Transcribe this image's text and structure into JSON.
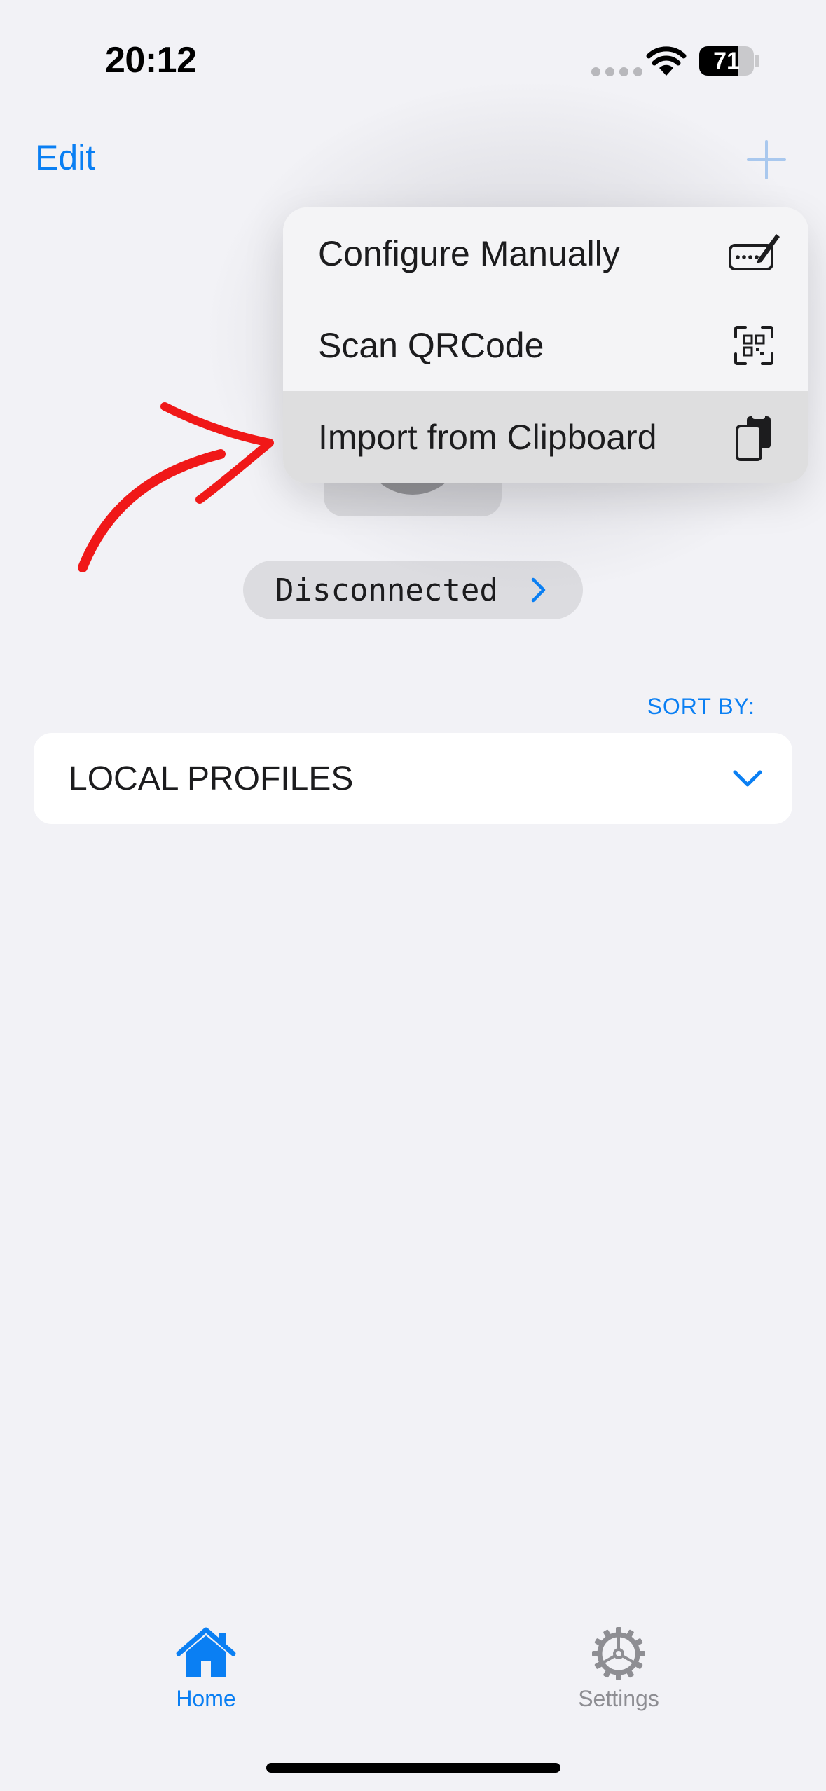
{
  "status_bar": {
    "time": "20:12",
    "battery": "71"
  },
  "nav": {
    "edit_label": "Edit"
  },
  "status": {
    "label": "Disconnected"
  },
  "sort": {
    "label": "SORT BY:"
  },
  "profiles": {
    "title": "LOCAL PROFILES"
  },
  "menu": {
    "items": [
      {
        "label": "Configure Manually",
        "icon": "keyboard-pen-icon"
      },
      {
        "label": "Scan QRCode",
        "icon": "qr-scan-icon"
      },
      {
        "label": "Import from Clipboard",
        "icon": "clipboard-copy-icon"
      }
    ]
  },
  "tabs": [
    {
      "label": "Home",
      "icon": "home-icon",
      "active": true
    },
    {
      "label": "Settings",
      "icon": "gear-icon",
      "active": false
    }
  ],
  "colors": {
    "accent": "#0a7ff3",
    "background": "#f2f2f6",
    "annotation": "#f01818"
  }
}
